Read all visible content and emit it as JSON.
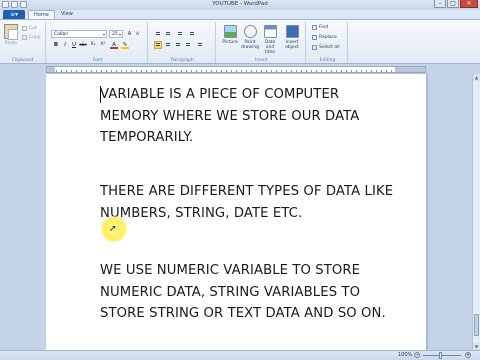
{
  "window": {
    "title": "YOUTUBE - WordPad"
  },
  "tabs": {
    "app_menu_icon": "menu-icon",
    "home": "Home",
    "view": "View"
  },
  "ribbon": {
    "clipboard": {
      "label": "Clipboard",
      "paste": "Paste",
      "cut": "Cut",
      "copy": "Copy"
    },
    "font": {
      "label": "Font",
      "family": "Calibri",
      "size": "25",
      "bold": "B",
      "italic": "I",
      "underline": "U",
      "strike": "abc",
      "subscript": "X₂",
      "superscript": "X²",
      "color": "A",
      "grow": "A",
      "shrink": "A"
    },
    "paragraph": {
      "label": "Paragraph"
    },
    "insert": {
      "label": "Insert",
      "picture": "Picture",
      "paint": "Paint drawing",
      "datetime": "Date and time",
      "object": "Insert object"
    },
    "editing": {
      "label": "Editing",
      "find": "Find",
      "replace": "Replace",
      "select_all": "Select all"
    }
  },
  "document": {
    "paragraphs": [
      "VARIABLE IS A PIECE OF COMPUTER MEMORY WHERE WE STORE OUR DATA TEMPORARILY.",
      "THERE ARE DIFFERENT TYPES OF DATA LIKE NUMBERS, STRING, DATE ETC.",
      "WE USE NUMERIC VARIABLE TO STORE NUMERIC DATA, STRING VARIABLES TO STORE STRING OR TEXT DATA AND SO ON."
    ]
  },
  "statusbar": {
    "zoom": "100%",
    "zoom_out": "−",
    "zoom_in": "+"
  },
  "colors": {
    "accent": "#1f5fb2",
    "ribbon_bg": "#e2eaf5",
    "active_button": "#ffd977",
    "cursor_highlight": "#ffee58"
  }
}
